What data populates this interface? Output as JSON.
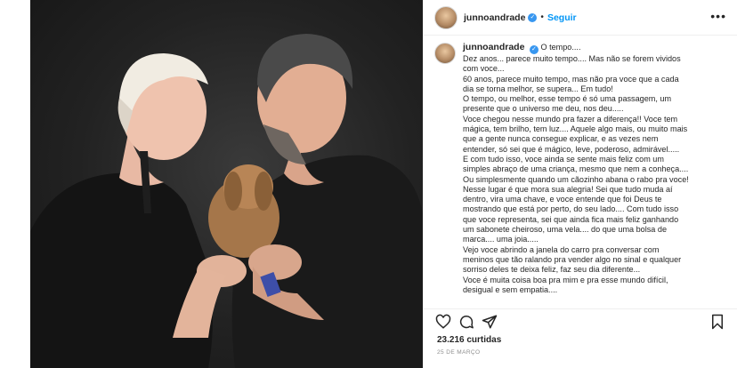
{
  "post": {
    "username": "junnoandrade",
    "verified_icon": "verified-badge-icon",
    "follow_label": "Seguir",
    "more_icon": "more-options-icon",
    "separator": "•"
  },
  "caption": {
    "username": "junnoandrade",
    "first_line_text": "O tempo....",
    "lines": [
      "Dez anos... parece muito tempo.... Mas não se forem vividos",
      "com voce...",
      "60 anos, parece muito tempo, mas não pra voce que a cada",
      "dia se torna melhor, se supera... Em tudo!",
      "O tempo, ou melhor, esse tempo é só uma passagem, um",
      "presente que o universo me deu, nos deu.....",
      "Voce chegou nesse mundo pra fazer a diferença!! Voce tem",
      "mágica, tem brilho, tem luz.... Aquele algo mais, ou muito mais",
      "que a gente nunca consegue explicar, e as vezes nem",
      "entender, só sei que é mágico, leve, poderoso, admirável.....",
      "E com tudo isso, voce ainda se sente mais feliz com um",
      "simples abraço de uma criança, mesmo que nem a conheça....",
      "Ou simplesmente quando um cãozinho abana o rabo pra voce!",
      "Nesse lugar é que mora sua alegria! Sei que tudo muda aí",
      "dentro, vira uma chave, e voce entende que foi Deus te",
      "mostrando que está por perto, do seu lado.... Com tudo isso",
      "que voce representa, sei que ainda fica mais feliz ganhando",
      "um sabonete cheiroso, uma vela.... do que uma bolsa de",
      "marca.... uma joia.....",
      "Vejo voce abrindo a janela do carro pra conversar com",
      "meninos que tão ralando pra vender algo no sinal e qualquer",
      "sorriso deles te deixa feliz, faz seu dia diferente...",
      "Voce é muita coisa boa pra mim e pra esse mundo difícil,",
      "desigual e sem empatia...."
    ]
  },
  "actions": {
    "like_icon": "heart-icon",
    "comment_icon": "comment-icon",
    "share_icon": "share-icon",
    "save_icon": "bookmark-icon"
  },
  "likes_text": "23.216 curtidas",
  "date_text": "25 DE MARÇO",
  "colors": {
    "link_blue": "#0095f6",
    "verified_blue": "#3897f0",
    "text": "#262626",
    "muted": "#8e8e8e"
  }
}
